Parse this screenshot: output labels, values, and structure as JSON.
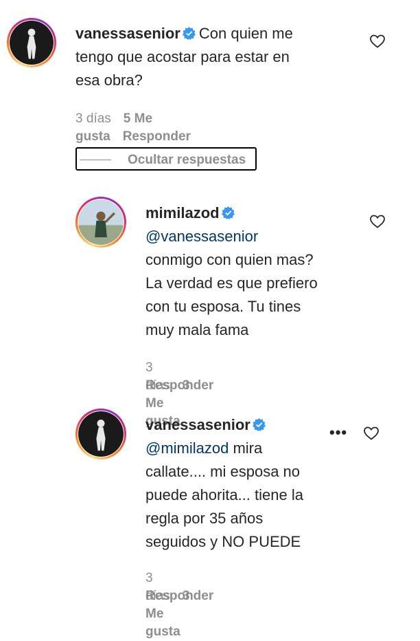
{
  "comments": [
    {
      "username": "vanessasenior",
      "text": "Con quien me tengo que acostar para estar en esa obra?",
      "lines": [
        "Con quien me",
        "tengo que acostar para estar en",
        "esa obra?"
      ],
      "date": "3 días",
      "likes": "5 Me gusta",
      "reply": "Responder"
    },
    {
      "username": "mimilazod",
      "mention": "@vanessasenior",
      "lines": [
        "conmigo con quien mas?",
        "La verdad es que prefiero",
        "con tu esposa. Tu tines",
        "muy mala fama"
      ],
      "date": "3 días",
      "likes": "3 Me gusta",
      "reply": "Responder"
    },
    {
      "username": "vanessasenior",
      "mention": "@mimilazod",
      "lines": [
        " mira",
        "callate.... mi esposa no",
        "puede ahorita... tiene la",
        "regla por 35 años",
        "seguidos y NO PUEDE"
      ],
      "date": "3 días",
      "likes": "3 Me gusta",
      "reply": "Responder",
      "more": "•••"
    }
  ],
  "hide_replies_label": "Ocultar respuestas",
  "icons": {
    "like": "heart-icon",
    "verified": "verified-badge-icon",
    "more": "more-options-icon"
  },
  "colors": {
    "verified": "#3897f0",
    "mention": "#00376b",
    "muted": "#8e8e8e"
  }
}
